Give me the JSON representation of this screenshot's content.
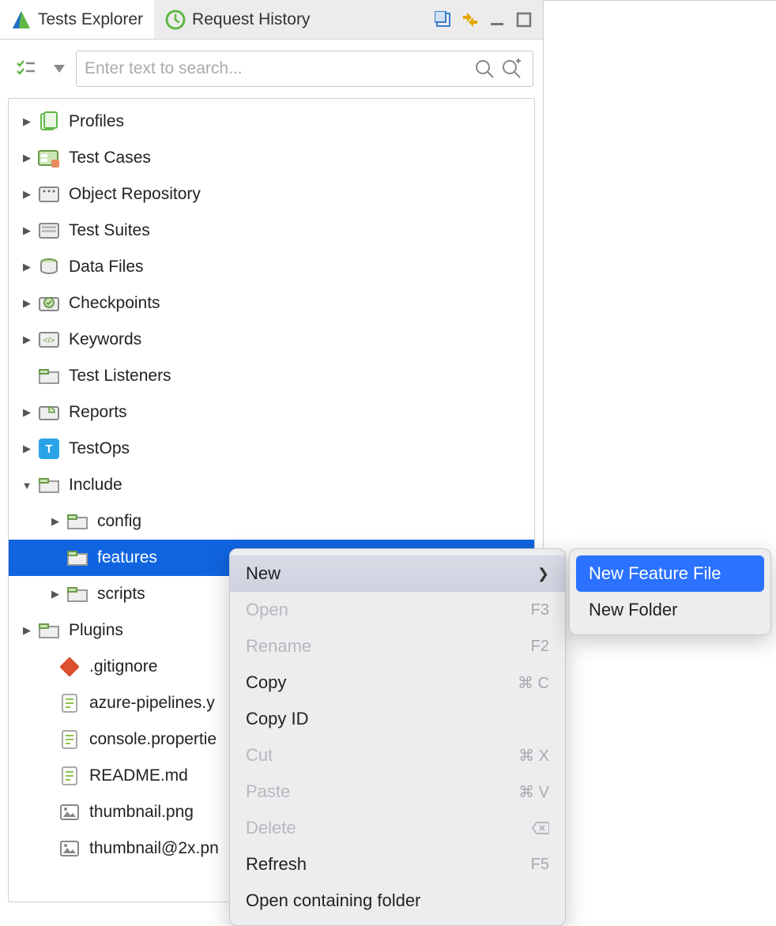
{
  "tabs": {
    "tests_explorer": "Tests Explorer",
    "request_history": "Request History"
  },
  "search": {
    "placeholder": "Enter text to search..."
  },
  "tree": {
    "profiles": "Profiles",
    "test_cases": "Test Cases",
    "object_repository": "Object Repository",
    "test_suites": "Test Suites",
    "data_files": "Data Files",
    "checkpoints": "Checkpoints",
    "keywords": "Keywords",
    "test_listeners": "Test Listeners",
    "reports": "Reports",
    "testops": "TestOps",
    "include": "Include",
    "config": "config",
    "features": "features",
    "scripts": "scripts",
    "plugins": "Plugins",
    "gitignore": ".gitignore",
    "azure": "azure-pipelines.y",
    "console": "console.propertie",
    "readme": "README.md",
    "thumb": "thumbnail.png",
    "thumb2x": "thumbnail@2x.pn"
  },
  "context_menu": {
    "new": "New",
    "open": "Open",
    "rename": "Rename",
    "copy": "Copy",
    "copy_id": "Copy ID",
    "cut": "Cut",
    "paste": "Paste",
    "delete": "Delete",
    "refresh": "Refresh",
    "open_folder": "Open containing folder",
    "shortcuts": {
      "open": "F3",
      "rename": "F2",
      "copy": "⌘ C",
      "cut": "⌘ X",
      "paste": "⌘ V",
      "refresh": "F5"
    }
  },
  "submenu": {
    "new_feature": "New Feature File",
    "new_folder": "New Folder"
  }
}
